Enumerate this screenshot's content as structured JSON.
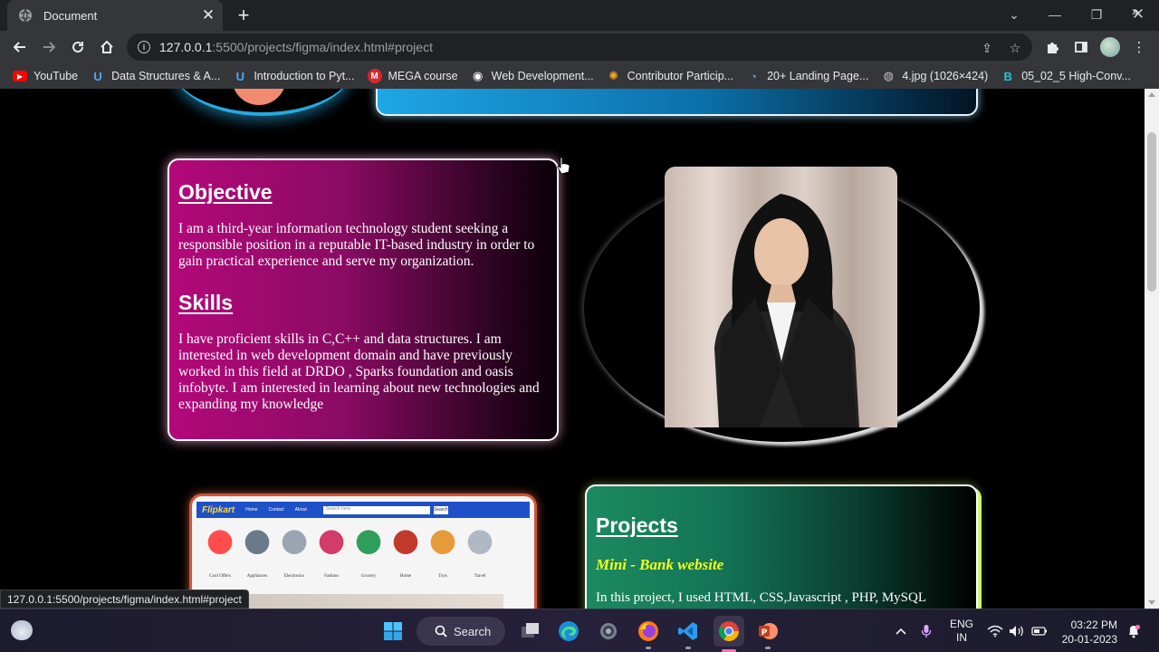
{
  "browser": {
    "tab_title": "Document",
    "url_host": "127.0.0.1",
    "url_rest": ":5500/projects/figma/index.html#project",
    "status_url": "127.0.0.1:5500/projects/figma/index.html#project"
  },
  "bookmarks": [
    {
      "label": "YouTube",
      "icon": "youtube-icon",
      "color": "#ff0000"
    },
    {
      "label": "Data Structures & A...",
      "icon": "udemy-icon",
      "color": "#4aa8ff"
    },
    {
      "label": "Introduction to Pyt...",
      "icon": "udemy-icon",
      "color": "#4aa8ff"
    },
    {
      "label": "MEGA course",
      "icon": "mega-icon",
      "color": "#d9272e"
    },
    {
      "label": "Web Development...",
      "icon": "web-icon",
      "color": "#ffffff"
    },
    {
      "label": "Contributor Particip...",
      "icon": "gear-icon",
      "color": "#f5a623"
    },
    {
      "label": "20+ Landing Page...",
      "icon": "clock-icon",
      "color": "#4aa8ff"
    },
    {
      "label": "4.jpg (1026×424)",
      "icon": "globe-icon",
      "color": "#bdc1c6"
    },
    {
      "label": "05_02_5 High-Conv...",
      "icon": "b-icon",
      "color": "#27c3e0"
    }
  ],
  "page": {
    "objective": {
      "heading": "Objective",
      "text": "I am a third-year information technology student seeking a responsible position in a reputable IT-based industry in order to gain practical experience and serve my organization."
    },
    "skills": {
      "heading": "Skills",
      "text": "I have proficient skills in C,C++ and data structures. I am interested in web development domain and have previously worked in this field at DRDO , Sparks foundation and oasis infobyte. I am interested in learning about new technologies and expanding my knowledge"
    },
    "projects": {
      "heading": "Projects",
      "subheading": "Mini - Bank website",
      "text": "In this project, I used HTML, CSS,Javascript , PHP, MySQL"
    },
    "flipkart_preview": {
      "brand": "Flipkart",
      "nav": [
        "Home",
        "Contact",
        "About"
      ],
      "search_placeholder": "Search here",
      "search_button": "Search",
      "products": [
        "Cool Offers",
        "Appliances",
        "Electronics",
        "Fashion",
        "Grocery",
        "Home",
        "Toys",
        "Travel"
      ]
    }
  },
  "taskbar": {
    "search_label": "Search",
    "lang_top": "ENG",
    "lang_bottom": "IN",
    "time": "03:22 PM",
    "date": "20-01-2023"
  },
  "colors": {
    "objective_card": "#b4087a",
    "projects_card": "#1c8a60",
    "projects_sub": "#f2ff1e",
    "accent_blue": "#1ea6e6"
  }
}
